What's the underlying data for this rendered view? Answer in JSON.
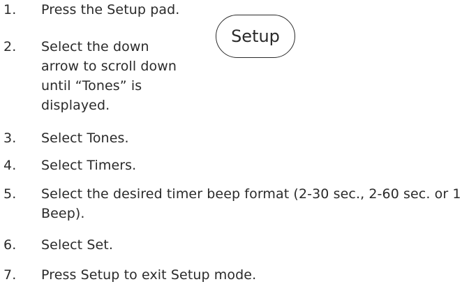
{
  "steps": [
    {
      "number": "1.",
      "text": "Press the Setup pad."
    },
    {
      "number": "2.",
      "text": "Select the down arrow to scroll down until “Tones” is displayed."
    },
    {
      "number": "3.",
      "text": "Select Tones."
    },
    {
      "number": "4.",
      "text": "Select Timers."
    },
    {
      "number": "5.",
      "text": "Select the desired timer beep format (2-30 sec., 2-60 sec. or 1 Beep)."
    },
    {
      "number": "6.",
      "text": "Select Set."
    },
    {
      "number": "7.",
      "text": "Press Setup to exit Setup mode."
    }
  ],
  "setup_pad": {
    "label": "Setup"
  }
}
